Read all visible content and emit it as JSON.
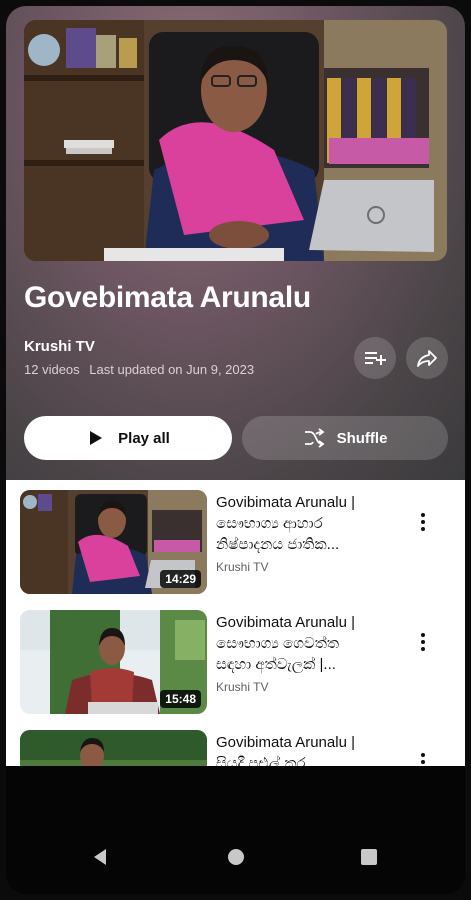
{
  "playlist": {
    "title": "Govebimata Arunalu",
    "channel": "Krushi TV",
    "video_count": "12 videos",
    "last_updated": "Last updated on Jun 9, 2023"
  },
  "actions": {
    "play_all_label": "Play all",
    "shuffle_label": "Shuffle"
  },
  "videos": [
    {
      "title_line1": "Govibimata Arunalu |",
      "title_line2": "සෞභාග්‍ය ආහාර",
      "title_line3": "නිෂ්පාදනය ජාතික...",
      "channel": "Krushi TV",
      "duration": "14:29"
    },
    {
      "title_line1": "Govibimata Arunalu |",
      "title_line2": "සෞභාග්‍ය ගෙවත්ත",
      "title_line3": "සඳහා අත්වැලක් |...",
      "channel": "Krushi TV",
      "duration": "15:48"
    },
    {
      "title_line1": "Govibimata Arunalu |",
      "title_line2": "සියදී පළුල් කර",
      "title_line3": "",
      "channel": "",
      "duration": ""
    }
  ],
  "icons": {
    "save": "playlist-add-icon",
    "share": "share-icon",
    "play": "play-icon",
    "shuffle": "shuffle-icon",
    "more": "more-vert-icon",
    "back": "back-icon",
    "home": "home-icon",
    "recents": "recents-icon"
  },
  "colors": {
    "accent_pink": "#d93b8a",
    "header_bg": "#5b4a52",
    "list_bg": "#ffffff"
  }
}
